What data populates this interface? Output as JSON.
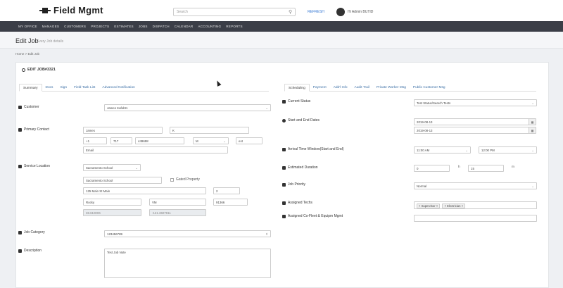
{
  "header": {
    "logo_text": "Field Mgmt",
    "search_placeholder": "Search",
    "refresh_label": "REFRESH",
    "user_label": "Hi Admin BUTID"
  },
  "nav": [
    "MY OFFICE",
    "MANAGES",
    "CUSTOMERS",
    "PROJECTS",
    "ESTIMATES",
    "JOBS",
    "DISPATCH",
    "CALENDAR",
    "ACCOUNTING",
    "REPORTS"
  ],
  "page": {
    "title": "Edit Job",
    "subtitle": "Every Job details",
    "breadcrumb": "Home  >  Edit Job"
  },
  "card_title": "EDIT JOB#3321",
  "left_tabs": [
    "Summary",
    "Docs",
    "Sign",
    "Field Task List",
    "Advanced Notification"
  ],
  "right_tabs": [
    "Scheduling",
    "Payment",
    "Add'l Info",
    "Audit Trail",
    "Private Worker Msg",
    "Public Customer Msg"
  ],
  "left": {
    "customer": {
      "label": "Customer",
      "value": "James Kafebt1"
    },
    "primary_contact": {
      "label": "Primary Contact",
      "first": "James",
      "last": "K",
      "phone1": "+1",
      "phone2": "717",
      "phone3": "449698",
      "type": "M",
      "ext": "ext",
      "email": "Email"
    },
    "service_location": {
      "label": "Service Location",
      "select": "Sacramento School",
      "name": "Sacramento School",
      "gated": "Gated Property",
      "address": "125 Main St Main",
      "unit": "2",
      "city": "Rocky",
      "state": "VM",
      "zip": "91366",
      "lat": "38.610006",
      "lng": "-121.3607911"
    },
    "job_category": {
      "label": "Job Category",
      "value": "123456789"
    },
    "description": {
      "label": "Description",
      "value": "Test Job Note"
    }
  },
  "right": {
    "current_status": {
      "label": "Current Status",
      "value": "Test Status/Search Tests"
    },
    "dates": {
      "label": "Start and End Dates",
      "start": "2019-08-13",
      "end": "2019-08-13"
    },
    "arrival": {
      "label": "Arrival Time Window(Start and End)",
      "start": "11:00 AM",
      "end": "12:00 PM"
    },
    "duration": {
      "label": "Estimated Duration",
      "hours": "0",
      "h_unit": "h",
      "minutes": "15",
      "m_unit": "m"
    },
    "priority": {
      "label": "Job Priority",
      "value": "Normal"
    },
    "techs": {
      "label": "Assigned Techs",
      "tags": [
        "Supervisor",
        "Electrician"
      ]
    },
    "cofleet": {
      "label": "Assigned Co-Fleet & Equipm Mgmt",
      "value": ""
    }
  }
}
